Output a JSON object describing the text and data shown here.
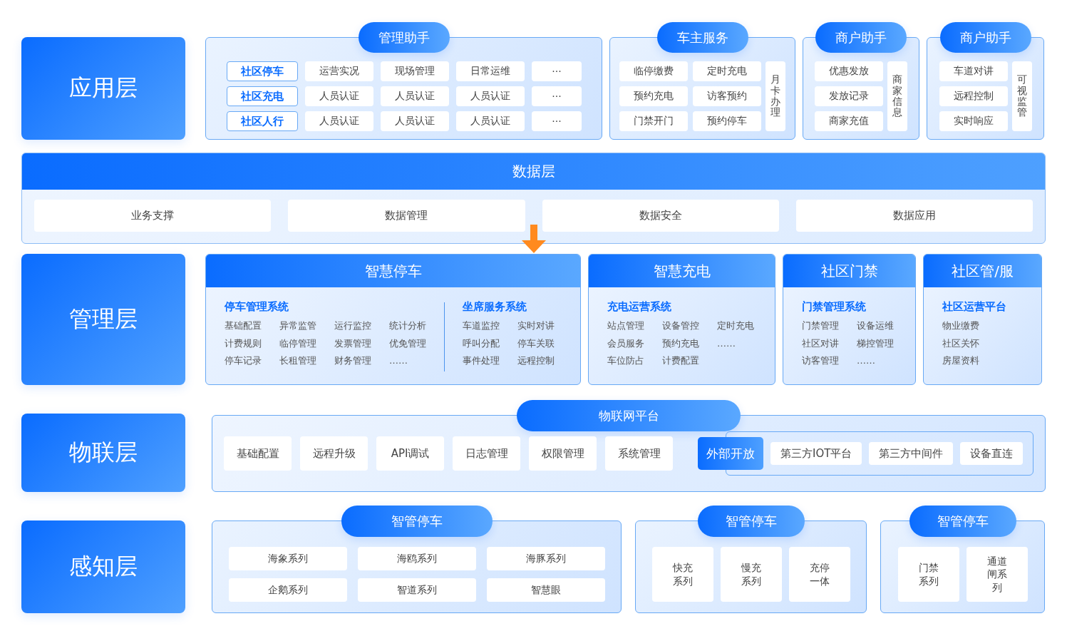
{
  "application_layer": {
    "label": "应用层",
    "panels": [
      {
        "kind": "matrix",
        "title": "管理助手",
        "rows": [
          {
            "tag": "社区停车",
            "items": [
              "运营实况",
              "现场管理",
              "日常运维",
              "···"
            ]
          },
          {
            "tag": "社区充电",
            "items": [
              "人员认证",
              "人员认证",
              "人员认证",
              "···"
            ]
          },
          {
            "tag": "社区人行",
            "items": [
              "人员认证",
              "人员认证",
              "人员认证",
              "···"
            ]
          }
        ]
      },
      {
        "kind": "grid_side",
        "title": "车主服务",
        "items": [
          "临停缴费",
          "定时充电",
          "预约充电",
          "访客预约",
          "门禁开门",
          "预约停车"
        ],
        "side": "月卡办理"
      },
      {
        "kind": "grid_side",
        "title": "商户助手",
        "items": [
          "优惠发放",
          "发放记录",
          "商家充值"
        ],
        "side": "商家信息"
      },
      {
        "kind": "grid_side",
        "title": "商户助手",
        "items": [
          "车道对讲",
          "远程控制",
          "实时响应"
        ],
        "side": "可视监管"
      }
    ]
  },
  "data_layer": {
    "title": "数据层",
    "items": [
      "业务支撑",
      "数据管理",
      "数据安全",
      "数据应用"
    ]
  },
  "management_layer": {
    "label": "管理层",
    "panels": [
      {
        "title": "智慧停车",
        "systems": [
          {
            "name": "停车管理系统",
            "items": [
              "基础配置",
              "异常监管",
              "运行监控",
              "统计分析",
              "计费规则",
              "临停管理",
              "发票管理",
              "优免管理",
              "停车记录",
              "长租管理",
              "财务管理",
              "……"
            ]
          },
          {
            "name": "坐席服务系统",
            "items": [
              "车道监控",
              "实时对讲",
              "呼叫分配",
              "停车关联",
              "事件处理",
              "远程控制"
            ]
          }
        ]
      },
      {
        "title": "智慧充电",
        "systems": [
          {
            "name": "充电运营系统",
            "items": [
              "站点管理",
              "设备管控",
              "定时充电",
              "会员服务",
              "预约充电",
              "……",
              "车位防占",
              "计费配置"
            ]
          }
        ]
      },
      {
        "title": "社区门禁",
        "systems": [
          {
            "name": "门禁管理系统",
            "items": [
              "门禁管理",
              "设备运维",
              "社区对讲",
              "梯控管理",
              "访客管理",
              "……"
            ]
          }
        ]
      },
      {
        "title": "社区管/服",
        "systems": [
          {
            "name": "社区运营平台",
            "items": [
              "物业缴费",
              "社区关怀",
              "房屋资料"
            ]
          }
        ]
      }
    ]
  },
  "iot_layer": {
    "label": "物联层",
    "title": "物联网平台",
    "items": [
      "基础配置",
      "远程升级",
      "API调试",
      "日志管理",
      "权限管理",
      "系统管理"
    ],
    "open": {
      "title": "外部开放",
      "items": [
        "第三方IOT平台",
        "第三方中间件",
        "设备直连"
      ]
    }
  },
  "perception_layer": {
    "label": "感知层",
    "panels": [
      {
        "title": "智管停车",
        "items": [
          "海象系列",
          "海鸥系列",
          "海豚系列",
          "企鹅系列",
          "智道系列",
          "智慧眼"
        ]
      },
      {
        "title": "智管停车",
        "items": [
          "快充系列",
          "慢充系列",
          "充停一体"
        ]
      },
      {
        "title": "智管停车",
        "items": [
          "门禁系列",
          "通道闸系列"
        ]
      }
    ]
  }
}
